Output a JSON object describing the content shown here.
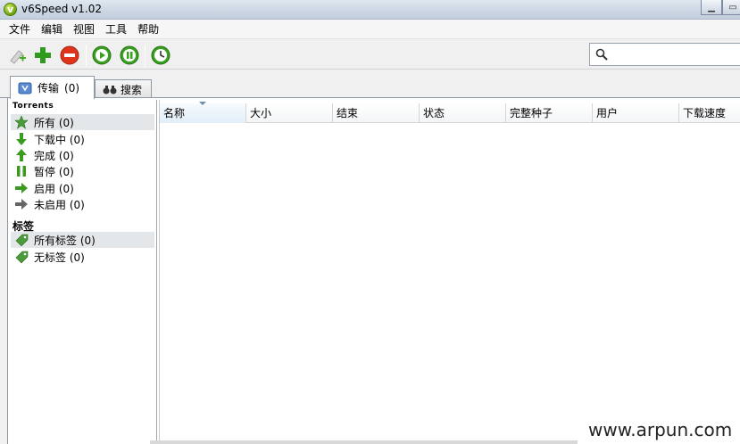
{
  "window": {
    "title": "v6Speed v1.02"
  },
  "menu": [
    "文件",
    "编辑",
    "视图",
    "工具",
    "帮助"
  ],
  "toolbar": {
    "buttons": [
      {
        "name": "add-torrent-link-icon"
      },
      {
        "name": "add-icon"
      },
      {
        "name": "remove-icon"
      },
      {
        "name": "start-icon"
      },
      {
        "name": "pause-icon"
      },
      {
        "name": "scheduler-icon"
      }
    ],
    "search_placeholder": ""
  },
  "tabs": [
    {
      "label": "传输",
      "count": "(0)",
      "icon": "transfer-icon"
    },
    {
      "label": "搜索",
      "icon": "binoculars-icon"
    }
  ],
  "sidebar": {
    "torrents_heading": "Torrents",
    "items": [
      {
        "label": "所有 (0)",
        "icon": "star-icon",
        "color": "#4b9b3c"
      },
      {
        "label": "下载中 (0)",
        "icon": "arrow-down-icon",
        "color": "#3b9b1f"
      },
      {
        "label": "完成 (0)",
        "icon": "arrow-up-icon",
        "color": "#3b9b1f"
      },
      {
        "label": "暂停 (0)",
        "icon": "pause-icon",
        "color": "#3b9b1f"
      },
      {
        "label": "启用 (0)",
        "icon": "arrow-right-icon",
        "color": "#3b9b1f"
      },
      {
        "label": "未启用 (0)",
        "icon": "arrow-right-gray-icon",
        "color": "#666666"
      }
    ],
    "labels_heading": "标签",
    "label_items": [
      {
        "label": "所有标签 (0)",
        "icon": "tag-icon"
      },
      {
        "label": "无标签 (0)",
        "icon": "tag-icon"
      }
    ]
  },
  "table": {
    "columns": [
      "名称",
      "大小",
      "结束",
      "状态",
      "完整种子",
      "用户",
      "下载速度"
    ]
  },
  "watermark": "www.arpun.com"
}
